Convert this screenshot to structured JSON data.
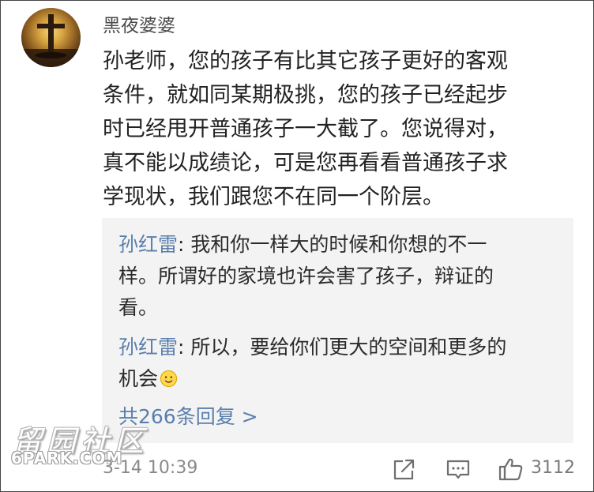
{
  "comment": {
    "username": "黑夜婆婆",
    "text_lines": [
      "孙老师，您的孩子有比其它孩子更好的客观",
      "条件，就如同某期极挑，您的孩子已经起步",
      "时已经甩开普通孩子一大截了。您说得对，",
      "真不能以成绩论，可是您再看看普通孩子求",
      "学现状，我们跟您不在同一个阶层。"
    ],
    "timestamp": "3-14 10:39",
    "like_count": "3112"
  },
  "replies": [
    {
      "author": "孙红雷",
      "separator": ": ",
      "lines": [
        "我和你一样大的时候和你想的不一",
        "样。所谓好的家境也许会害了孩子，辩证的",
        "看。"
      ]
    },
    {
      "author": "孙红雷",
      "separator": ": ",
      "lines": [
        "所以，要给你们更大的空间和更多的",
        "机会"
      ],
      "emoji": "smile-emoji"
    }
  ],
  "more_replies_label": "共266条回复 >",
  "watermark": {
    "cn": "留园社区",
    "en": "6PARK.COM"
  },
  "icons": {
    "avatar": "avatar-cross-sunset",
    "share": "share-icon",
    "comment": "comment-icon",
    "like": "thumbs-up-icon"
  },
  "colors": {
    "link": "#5a7fad",
    "reply_bg": "#f3f3f3",
    "meta": "#8a8a8a"
  }
}
